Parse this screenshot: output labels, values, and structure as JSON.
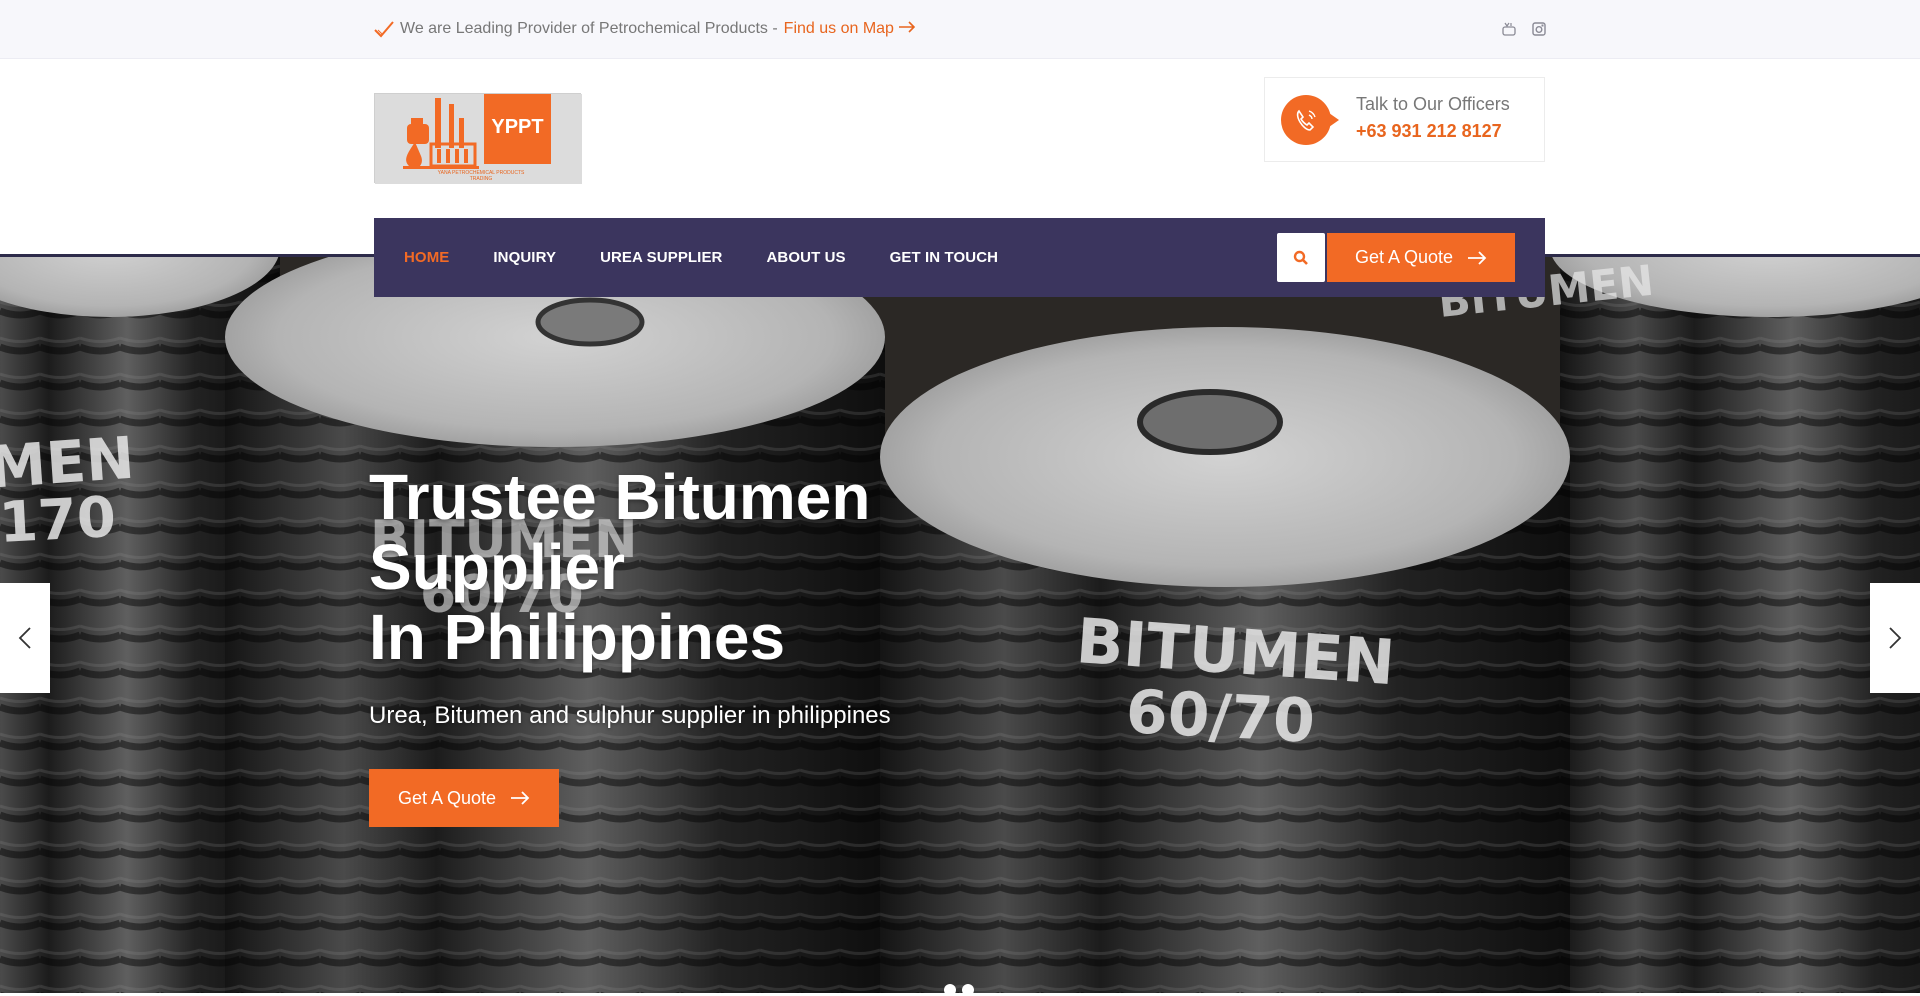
{
  "topbar": {
    "message": "We are Leading Provider of Petrochemical Products -",
    "map_link": "Find us on Map",
    "icons": [
      "check-icon",
      "arrow-right-icon",
      "youtube-icon",
      "instagram-icon"
    ]
  },
  "logo": {
    "text": "YPPT",
    "subtext": "YANA PETROCHEMICAL PRODUCTS TRADING"
  },
  "contact": {
    "label": "Talk to Our Officers",
    "phone": "+63 931 212 8127",
    "icon": "phone-icon"
  },
  "nav": {
    "items": [
      {
        "label": "HOME",
        "active": true
      },
      {
        "label": "INQUIRY",
        "active": false
      },
      {
        "label": "UREA SUPPLIER",
        "active": false
      },
      {
        "label": "ABOUT US",
        "active": false
      },
      {
        "label": "GET IN TOUCH",
        "active": false
      }
    ],
    "quote_button": "Get A Quote",
    "search_icon": "search-icon"
  },
  "hero": {
    "title_line1": "Trustee Bitumen",
    "title_line2": "Supplier",
    "title_line3": "In Philippines",
    "subtitle": "Urea, Bitumen and sulphur supplier in philippines",
    "button": "Get A Quote",
    "barrel_labels": [
      "MEN",
      "170",
      "BITUMEN",
      "60/70",
      "BITUMEN",
      "60/70",
      "BITUMEN"
    ],
    "slides": 2,
    "active_slide": 1
  },
  "colors": {
    "accent": "#f26a25",
    "nav_bg": "#3b355e",
    "topbar_bg": "#f7f7fb"
  }
}
